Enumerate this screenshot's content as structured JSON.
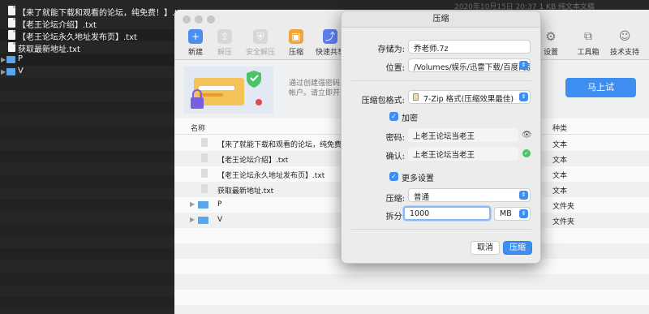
{
  "desktop": {
    "header_dim": "2020年10月15日 20:37   1 KB   纯文本文稿",
    "items": [
      {
        "label": "【来了就能下载和观看的论坛，纯免费！】.txt",
        "type": "file"
      },
      {
        "label": "【老王论坛介绍】.txt",
        "type": "file"
      },
      {
        "label": "【老王论坛永久地址发布页】.txt",
        "type": "file"
      },
      {
        "label": "获取最新地址.txt",
        "type": "file"
      },
      {
        "label": "P",
        "type": "folder"
      },
      {
        "label": "V",
        "type": "folder"
      }
    ]
  },
  "toolbar": {
    "new": "新建",
    "extract": "解压",
    "safe_extract": "安全解压",
    "compress": "压缩",
    "quick_share": "快速共享",
    "settings": "设置",
    "toolbox": "工具箱",
    "support": "技术支持"
  },
  "banner": {
    "text": "通过创建强密码帐户。请立即开",
    "try_button": "马上试"
  },
  "filelist": {
    "col_name": "名称",
    "col_kind": "种类",
    "rows": [
      {
        "name": "【来了就能下载和观看的论坛，纯免费！】",
        "kind": "文本",
        "type": "file"
      },
      {
        "name": "【老王论坛介绍】.txt",
        "kind": "文本",
        "type": "file"
      },
      {
        "name": "【老王论坛永久地址发布页】.txt",
        "kind": "文本",
        "type": "file"
      },
      {
        "name": "获取最新地址.txt",
        "kind": "文本",
        "type": "file"
      },
      {
        "name": "P",
        "kind": "文件夹",
        "type": "folder"
      },
      {
        "name": "V",
        "kind": "文件夹",
        "type": "folder"
      }
    ]
  },
  "dialog": {
    "title": "压缩",
    "save_as_label": "存储为:",
    "save_as_value": "乔老师.7z",
    "location_label": "位置:",
    "location_value": "/Volumes/娱乐/迅雷下载/百度网盘...",
    "format_label": "压缩包格式:",
    "format_value": "7-Zip 格式(压缩效果最佳)",
    "encrypt_label": "加密",
    "password_label": "密码:",
    "password_value": "上老王论坛当老王",
    "confirm_label": "确认:",
    "confirm_value": "上老王论坛当老王",
    "more_settings_label": "更多设置",
    "compression_label": "压缩:",
    "compression_value": "普通",
    "split_label": "拆分:",
    "split_value": "1000",
    "split_unit": "MB",
    "cancel_button": "取消",
    "ok_button": "压缩"
  },
  "colors": {
    "accent": "#3d8ef0",
    "folder": "#5aa6e8",
    "success": "#4cc26a"
  }
}
